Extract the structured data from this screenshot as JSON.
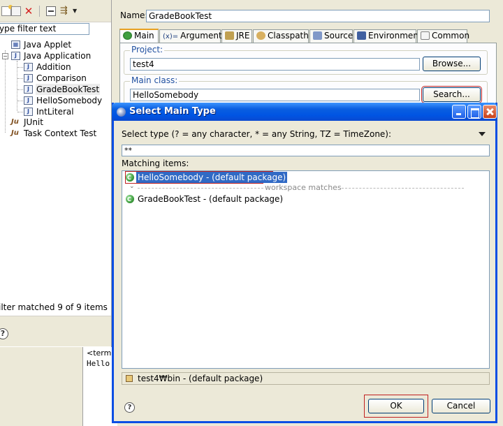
{
  "left_panel": {
    "filter_text": "ype filter text",
    "tree": [
      {
        "label": "Java Applet",
        "icon": "applet-icon"
      },
      {
        "label": "Java Application",
        "icon": "java-app-icon",
        "expanded": true
      },
      {
        "label": "Addition",
        "icon": "java-app-config-icon"
      },
      {
        "label": "Comparison",
        "icon": "java-app-config-icon"
      },
      {
        "label": "GradeBookTest",
        "icon": "java-app-config-icon",
        "selected": true
      },
      {
        "label": "HelloSomebody",
        "icon": "java-app-config-icon"
      },
      {
        "label": "IntLiteral",
        "icon": "java-app-config-icon"
      },
      {
        "label": "JUnit",
        "icon": "junit-icon"
      },
      {
        "label": "Task Context Test",
        "icon": "task-context-icon"
      }
    ],
    "filter_status": "ilter matched 9 of 9 items"
  },
  "console": {
    "title": "<termi",
    "output": "Hello"
  },
  "editor": {
    "name_label": "Name:",
    "name_value": "GradeBookTest",
    "tabs": [
      {
        "label": "Main",
        "active": true
      },
      {
        "label": "Arguments"
      },
      {
        "label": "JRE"
      },
      {
        "label": "Classpath"
      },
      {
        "label": "Source"
      },
      {
        "label": "Environment"
      },
      {
        "label": "Common"
      }
    ],
    "project_label": "Project:",
    "project_value": "test4",
    "browse_label": "Browse...",
    "main_class_label": "Main class:",
    "main_class_value": "HelloSomebody",
    "search_label": "Search..."
  },
  "dialog": {
    "title": "Select Main Type",
    "select_type_label": "Select type (? = any character, * = any String, TZ = TimeZone):",
    "pattern_value": "**",
    "matching_label": "Matching items:",
    "results": [
      {
        "label": "HelloSomebody - (default package)",
        "selected": true
      },
      {
        "label": "GradeBookTest - (default package)"
      }
    ],
    "separator_text": "workspace matches",
    "status_text": "test4₩bin - (default package)",
    "ok_label": "OK",
    "cancel_label": "Cancel"
  },
  "colors": {
    "selection": "#316ac5",
    "titlebar": "#0054e3",
    "highlight_border": "#c02020",
    "group_label": "#2050a0"
  }
}
